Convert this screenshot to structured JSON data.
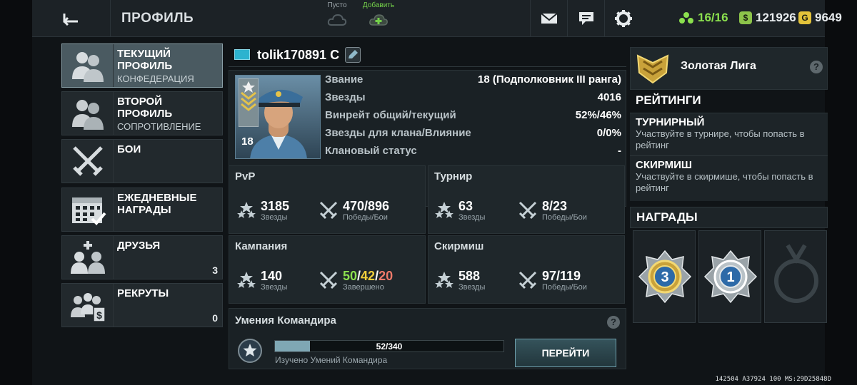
{
  "header": {
    "title": "ПРОФИЛЬ",
    "slot_empty_label": "Пусто",
    "slot_add_label": "Добавить",
    "resources": {
      "squads": "16/16",
      "money": "121926",
      "gold": "9649"
    },
    "colors": {
      "squads": "#8be04e",
      "money": "#d8dde0",
      "gold": "#d8dde0"
    }
  },
  "menu": {
    "items": [
      {
        "title": "ТЕКУЩИЙ ПРОФИЛЬ",
        "sub": "КОНФЕДЕРАЦИЯ",
        "icon": "soldiers-icon",
        "active": true
      },
      {
        "title": "ВТОРОЙ ПРОФИЛЬ",
        "sub": "СОПРОТИВЛЕНИЕ",
        "icon": "soldiers-icon",
        "active": false
      },
      {
        "title": "БОИ",
        "sub": "",
        "icon": "crossed-swords-icon",
        "active": false
      },
      {
        "title": "ЕЖЕДНЕВНЫЕ НАГРАДЫ",
        "sub": "",
        "icon": "calendar-icon",
        "active": false
      },
      {
        "title": "ДРУЗЬЯ",
        "sub": "",
        "count": "3",
        "icon": "friends-icon",
        "active": false
      },
      {
        "title": "РЕКРУТЫ",
        "sub": "",
        "count": "0",
        "icon": "recruits-icon",
        "active": false
      }
    ]
  },
  "profile": {
    "name": "tolik170891 C",
    "rank_level": "18",
    "rows": [
      {
        "k": "Звание",
        "v": "18 (Подполковник III ранга)"
      },
      {
        "k": "Звезды",
        "v": "4016"
      },
      {
        "k": "Винрейт общий/текущий",
        "v": "52%/46%"
      },
      {
        "k": "Звезды для клана/Влияние",
        "v": "0/0%"
      },
      {
        "k": "Клановый статус",
        "v": "-"
      }
    ]
  },
  "stats": {
    "pvp": {
      "title": "PvP",
      "stars": "3185",
      "stars_label": "Звезды",
      "wins": "470/896",
      "wins_label": "Победы/Бои"
    },
    "tournament": {
      "title": "Турнир",
      "stars": "63",
      "stars_label": "Звезды",
      "wins": "8/23",
      "wins_label": "Победы/Бои"
    },
    "campaign": {
      "title": "Кампания",
      "stars": "140",
      "stars_label": "Звезды",
      "done_a": "50",
      "sep1": "/",
      "done_b": "42",
      "sep2": "/",
      "done_c": "20",
      "done_label": "Завершено"
    },
    "skirmish": {
      "title": "Скирмиш",
      "stars": "588",
      "stars_label": "Звезды",
      "wins": "97/119",
      "wins_label": "Победы/Бои"
    }
  },
  "skills": {
    "title": "Умения Командира",
    "progress_text": "52/340",
    "progress_fraction": 0.153,
    "note": "Изучено Умений Командира",
    "button": "ПЕРЕЙТИ"
  },
  "right": {
    "league": "Золотая Лига",
    "ratings_title": "РЕЙТИНГИ",
    "ratings": [
      {
        "t": "ТУРНИРНЫЙ",
        "d": "Участвуйте в турнире, чтобы попасть в рейтинг"
      },
      {
        "t": "СКИРМИШ",
        "d": "Участвуйте в скирмише, чтобы попасть в рейтинг"
      }
    ],
    "awards_title": "НАГРАДЫ",
    "awards": [
      {
        "num": "3",
        "icon": "medal-3-icon"
      },
      {
        "num": "1",
        "icon": "medal-1-icon"
      },
      {
        "num": "",
        "icon": "medal-locked-icon"
      }
    ]
  },
  "debug": "142504 A37924 100 MS:29D25848D"
}
